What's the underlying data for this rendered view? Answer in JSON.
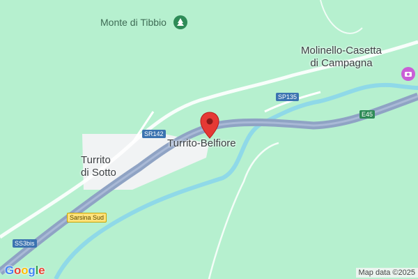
{
  "map": {
    "places": {
      "peak": "Monte di Tibbio",
      "marked_place": "Turrito-Belfiore",
      "turrito_sotto_line1": "Turrito",
      "turrito_sotto_line2": "di Sotto",
      "molinello_line1": "Molinello-Casetta",
      "molinello_line2": "di Campagna"
    },
    "road_shields": {
      "sp135": "SP135",
      "sr142": "SR142",
      "e45": "E45",
      "sarsina_sud": "Sarsina Sud",
      "ss3bis": "SS3bis"
    },
    "icons": {
      "peak": "park-icon",
      "attraction": "camera-icon",
      "pin": "map-pin-icon"
    },
    "colors": {
      "land": "#b6f0cf",
      "river": "#8fd9e8",
      "highway": "#8fa3c4",
      "settlement": "#f1f3f4",
      "pin": "#e53935"
    },
    "google_logo": {
      "G": "G",
      "o1": "o",
      "o2": "o",
      "g": "g",
      "l": "l",
      "e": "e"
    },
    "credits": "Map data ©2025"
  }
}
